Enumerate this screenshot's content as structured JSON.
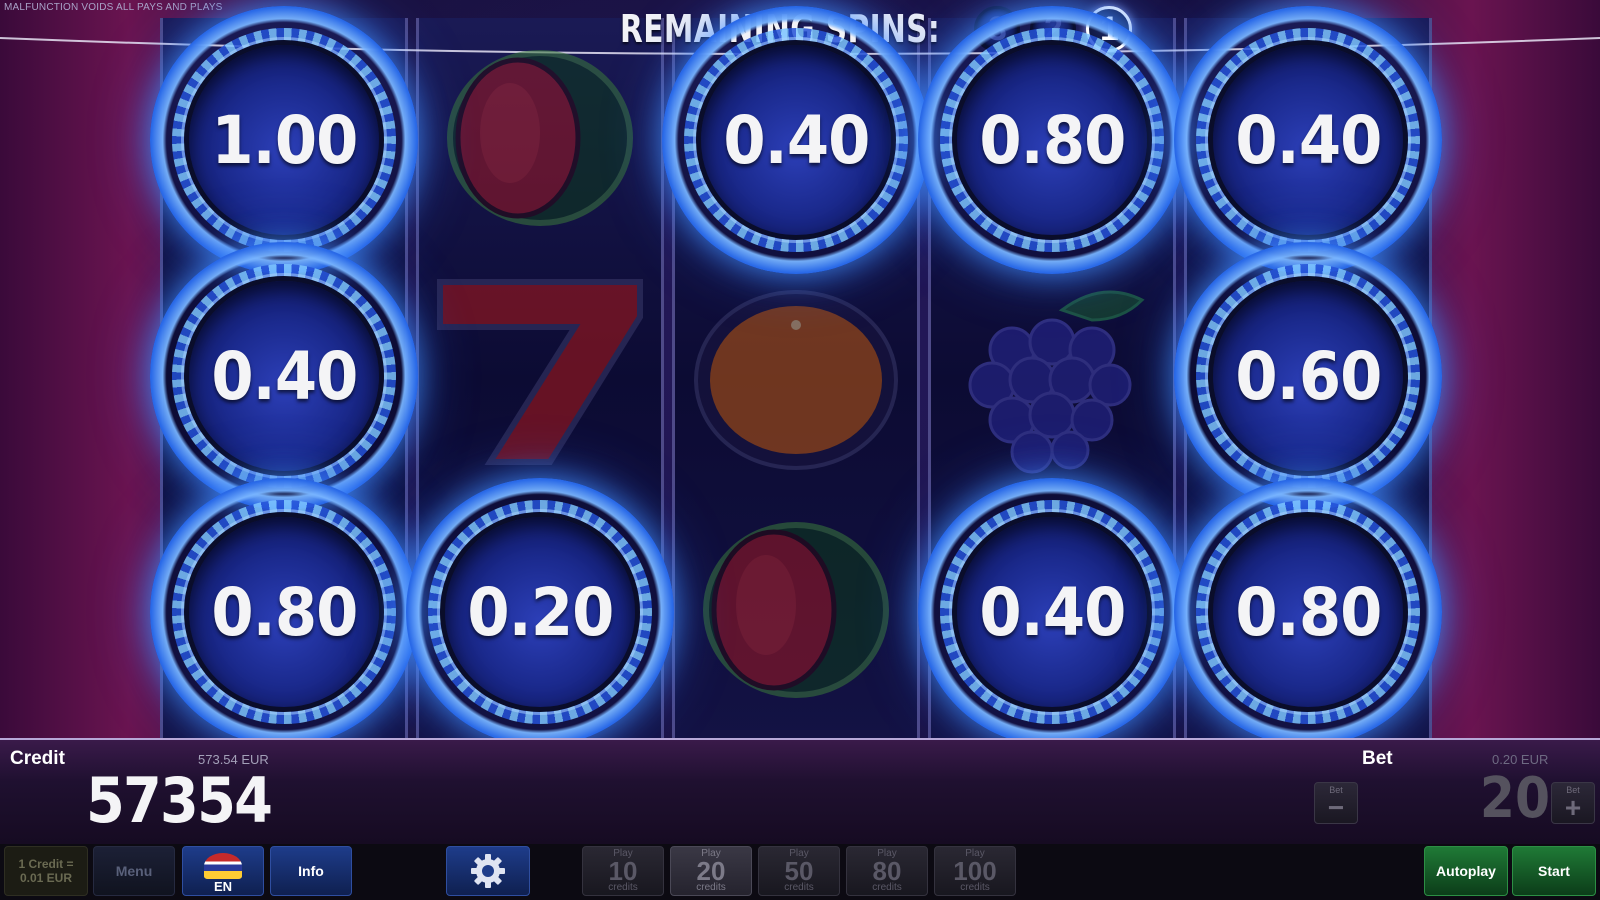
{
  "disclaimer": "MALFUNCTION VOIDS ALL PAYS AND PLAYS",
  "header": {
    "remaining_label": "REMAINING SPINS:",
    "spins": [
      "3",
      "2",
      "1"
    ],
    "active_spin": "1"
  },
  "reels": {
    "coins": [
      {
        "reel": 1,
        "row": 1,
        "value": "1.00"
      },
      {
        "reel": 1,
        "row": 2,
        "value": "0.40"
      },
      {
        "reel": 1,
        "row": 3,
        "value": "0.80"
      },
      {
        "reel": 2,
        "row": 3,
        "value": "0.20"
      },
      {
        "reel": 3,
        "row": 1,
        "value": "0.40"
      },
      {
        "reel": 4,
        "row": 1,
        "value": "0.80"
      },
      {
        "reel": 4,
        "row": 3,
        "value": "0.40"
      },
      {
        "reel": 5,
        "row": 1,
        "value": "0.40"
      },
      {
        "reel": 5,
        "row": 2,
        "value": "0.60"
      },
      {
        "reel": 5,
        "row": 3,
        "value": "0.80"
      }
    ],
    "symbols": [
      {
        "reel": 2,
        "row": 1,
        "icon": "watermelon-icon"
      },
      {
        "reel": 2,
        "row": 2,
        "icon": "seven-icon"
      },
      {
        "reel": 3,
        "row": 2,
        "icon": "orange-icon"
      },
      {
        "reel": 3,
        "row": 3,
        "icon": "watermelon-icon"
      },
      {
        "reel": 4,
        "row": 2,
        "icon": "grapes-icon"
      }
    ]
  },
  "credit": {
    "label": "Credit",
    "eur": "573.54 EUR",
    "value": "57354"
  },
  "bet": {
    "label": "Bet",
    "eur": "0.20 EUR",
    "value": "20",
    "minus_small": "Bet",
    "minus_symbol": "−",
    "plus_small": "Bet",
    "plus_symbol": "+"
  },
  "toolbar": {
    "credit_rate_line1": "1 Credit =",
    "credit_rate_line2": "0.01 EUR",
    "menu_label": "Menu",
    "lang_label": "EN",
    "info_label": "Info",
    "settings_icon": "gear-icon",
    "play_options": [
      {
        "top": "Play",
        "num": "10",
        "bottom": "credits"
      },
      {
        "top": "Play",
        "num": "20",
        "bottom": "credits"
      },
      {
        "top": "Play",
        "num": "50",
        "bottom": "credits"
      },
      {
        "top": "Play",
        "num": "80",
        "bottom": "credits"
      },
      {
        "top": "Play",
        "num": "100",
        "bottom": "credits"
      }
    ],
    "selected_play": "20",
    "autoplay_label": "Autoplay",
    "start_label": "Start"
  },
  "colors": {
    "coin_blue": "#2a6ae8",
    "autoplay_green": "#1f7a36",
    "info_blue": "#1e3c8a"
  }
}
